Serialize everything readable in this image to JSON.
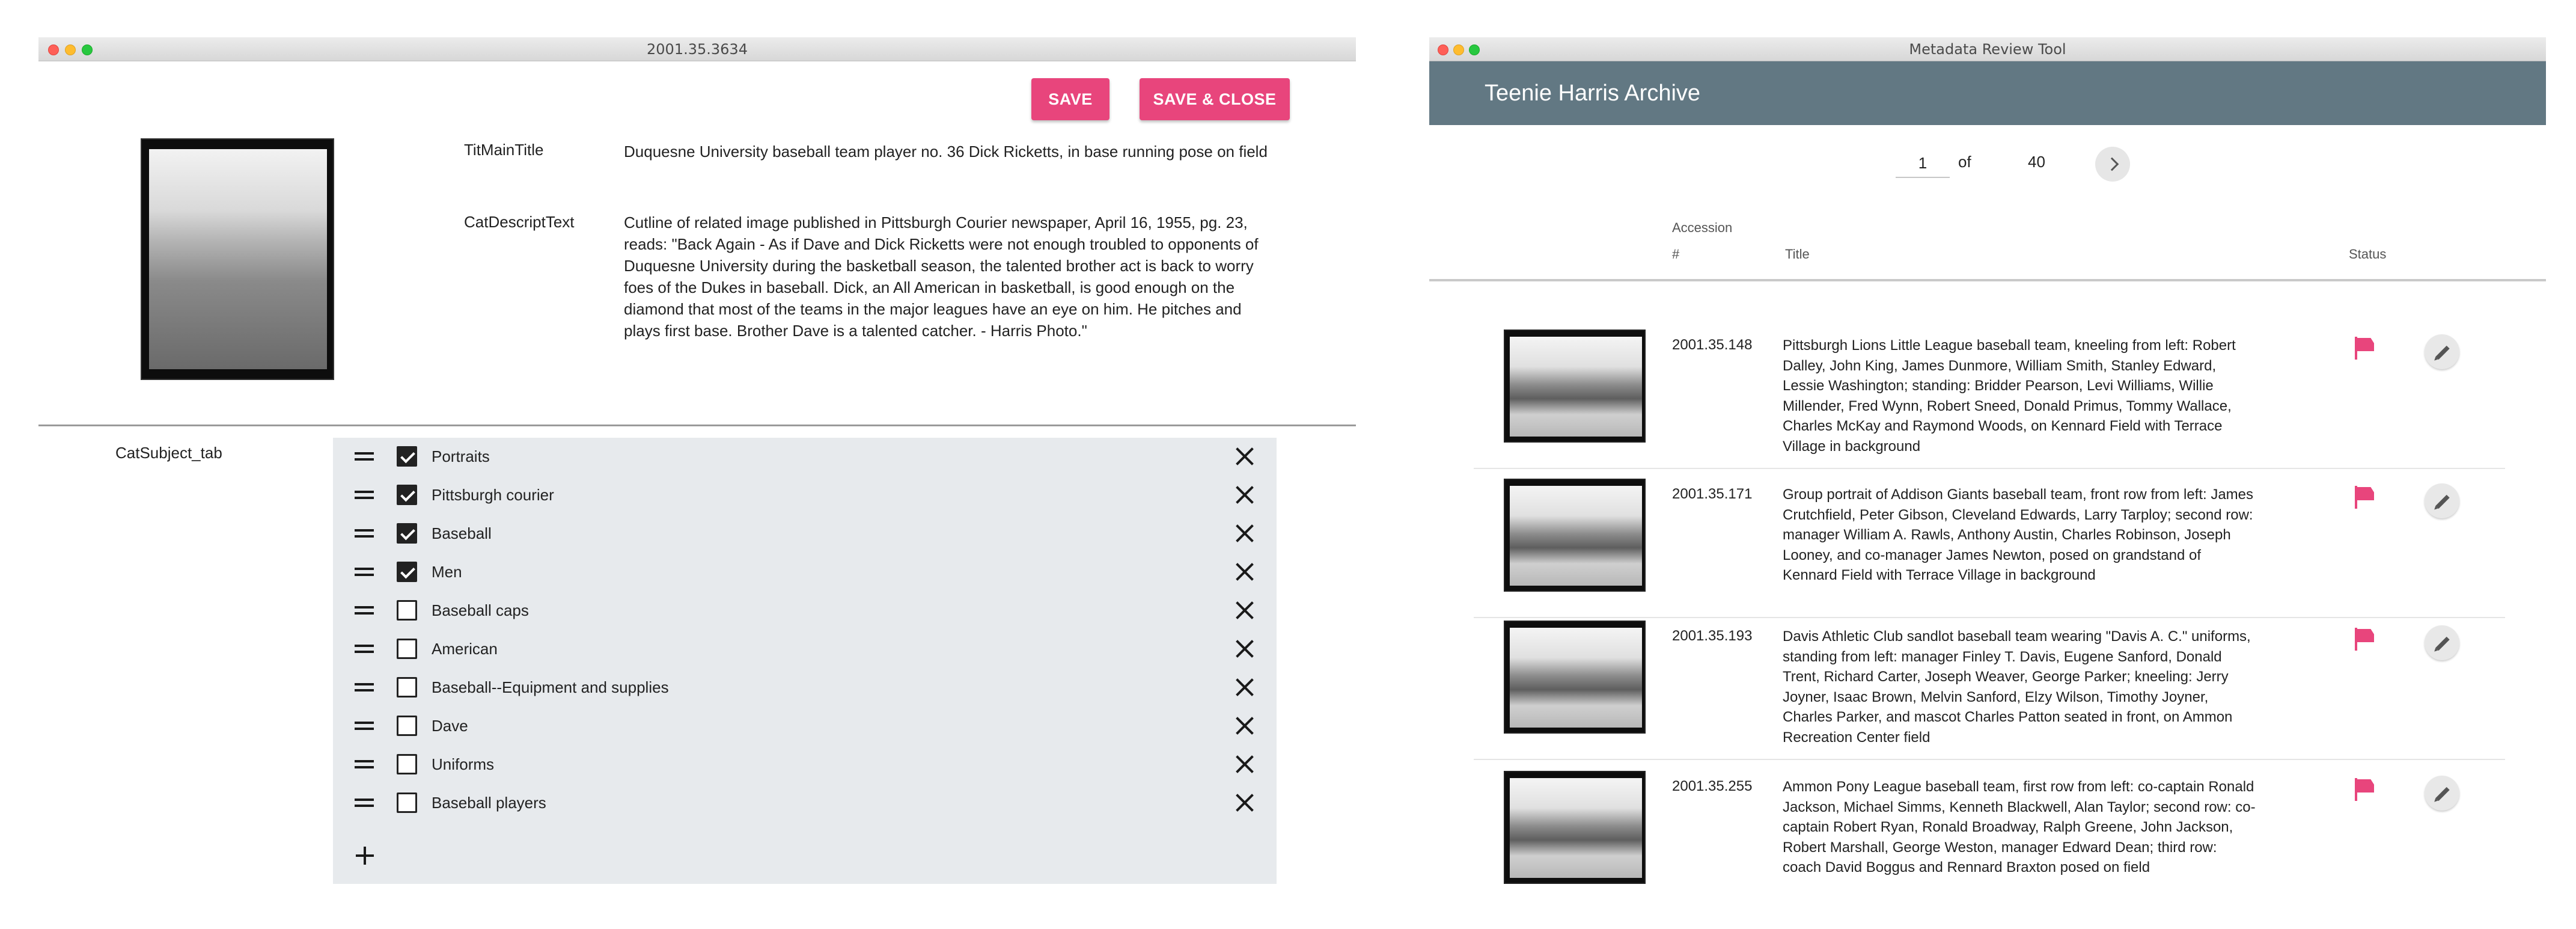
{
  "editor_window": {
    "title": "2001.35.3634",
    "save_label": "SAVE",
    "save_close_label": "SAVE & CLOSE",
    "fields": {
      "title_label": "TitMainTitle",
      "title_value": "Duquesne University baseball team player no. 36 Dick Ricketts, in base running pose on field",
      "desc_label": "CatDescriptText",
      "desc_value": "Cutline of related image published in Pittsburgh Courier newspaper, April 16, 1955, pg. 23, reads: \"Back Again - As if Dave and Dick Ricketts were not enough troubled to opponents of Duquesne University during the basketball season, the talented brother act is back to worry foes of the Dukes in baseball. Dick, an All American in basketball, is good enough on the diamond that most of the teams in the major leagues have an eye on him. He pitches and plays first base. Brother Dave is a talented catcher. - Harris Photo.\"",
      "subject_label": "CatSubject_tab"
    },
    "subjects": [
      {
        "label": "Portraits",
        "checked": true
      },
      {
        "label": "Pittsburgh courier",
        "checked": true
      },
      {
        "label": "Baseball",
        "checked": true
      },
      {
        "label": "Men",
        "checked": true
      },
      {
        "label": "Baseball caps",
        "checked": false
      },
      {
        "label": "American",
        "checked": false
      },
      {
        "label": "Baseball--Equipment and supplies",
        "checked": false
      },
      {
        "label": "Dave",
        "checked": false
      },
      {
        "label": "Uniforms",
        "checked": false
      },
      {
        "label": "Baseball players",
        "checked": false
      }
    ],
    "icons": {
      "drag": "drag-handle-icon",
      "remove": "close-icon",
      "add": "plus-icon"
    }
  },
  "review_window": {
    "title": "Metadata Review Tool",
    "app_title": "Teenie Harris Archive",
    "pagination": {
      "current": "1",
      "of_label": "of",
      "total": "40"
    },
    "columns": {
      "accession_line1": "Accession",
      "accession_line2": "#",
      "title": "Title",
      "status": "Status"
    },
    "records": [
      {
        "accession": "2001.35.148",
        "title": "Pittsburgh Lions Little League baseball team, kneeling from left: Robert Dalley, John King, James Dunmore, William Smith, Stanley Edward, Lessie Washington; standing: Bridder Pearson, Levi Williams, Willie Millender, Fred Wynn, Robert Sneed, Donald Primus, Tommy Wallace, Charles McKay and Raymond Woods, on Kennard Field with Terrace Village in background"
      },
      {
        "accession": "2001.35.171",
        "title": "Group portrait of Addison Giants baseball team, front row from left: James Crutchfield, Peter Gibson, Cleveland Edwards, Larry Tarploy; second row: manager William A. Rawls, Anthony Austin, Charles Robinson, Joseph Looney, and co-manager James Newton, posed on grandstand of Kennard Field with Terrace Village in background"
      },
      {
        "accession": "2001.35.193",
        "title": "Davis Athletic Club sandlot baseball team wearing \"Davis A. C.\" uniforms, standing from left: manager Finley T. Davis, Eugene Sanford, Donald Trent, Richard Carter, Joseph Weaver, George Parker; kneeling: Jerry Joyner, Isaac Brown, Melvin Sanford, Elzy Wilson, Timothy Joyner, Charles Parker, and mascot Charles Patton seated in front, on Ammon Recreation Center field"
      },
      {
        "accession": "2001.35.255",
        "title": "Ammon Pony League baseball team, first row from left: co-captain Ronald Jackson, Michael Simms, Kenneth Blackwell, Alan Taylor; second row: co-captain Robert Ryan, Ronald Broadway, Ralph Greene, John Jackson, Robert Marshall, George Weston, manager Edward Dean; third row: coach David Boggus and Rennard Braxton posed on field"
      }
    ],
    "icons": {
      "status": "flag-icon",
      "edit": "pencil-icon",
      "next": "chevron-right-icon"
    },
    "colors": {
      "header": "#627883",
      "accent": "#e8457c"
    }
  }
}
